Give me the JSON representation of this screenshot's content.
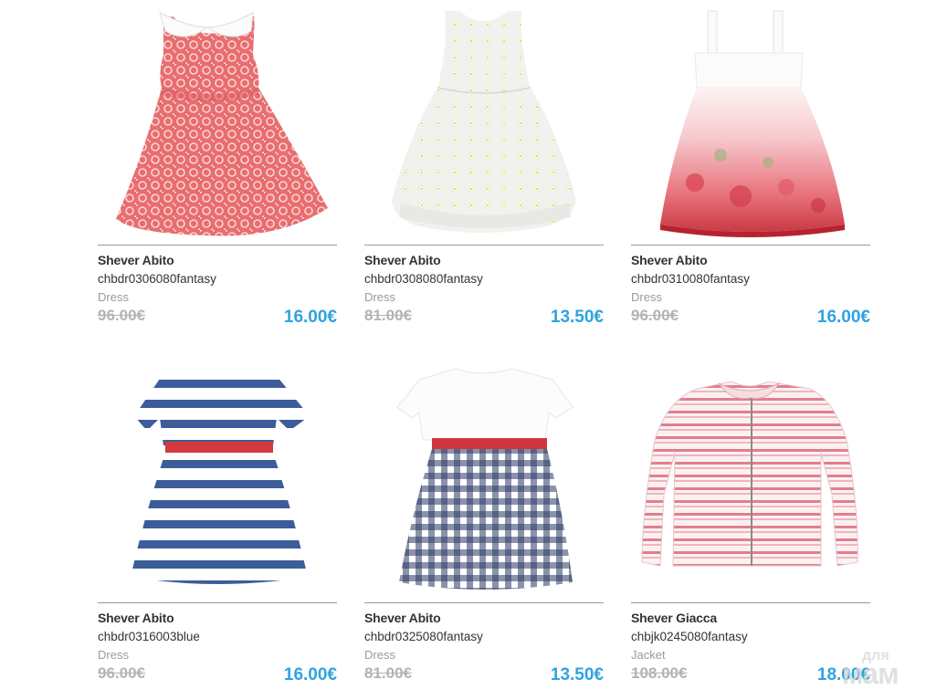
{
  "products": [
    {
      "name": "Shever Abito",
      "sku": "chbdr0306080fantasy",
      "category": "Dress",
      "old_price": "96.00€",
      "price": "16.00€",
      "image_icon": "pink-patterned-dress-image"
    },
    {
      "name": "Shever Abito",
      "sku": "chbdr0308080fantasy",
      "category": "Dress",
      "old_price": "81.00€",
      "price": "13.50€",
      "image_icon": "white-daisy-dress-image"
    },
    {
      "name": "Shever Abito",
      "sku": "chbdr0310080fantasy",
      "category": "Dress",
      "old_price": "96.00€",
      "price": "16.00€",
      "image_icon": "floral-strap-dress-image"
    },
    {
      "name": "Shever Abito",
      "sku": "chbdr0316003blue",
      "category": "Dress",
      "old_price": "96.00€",
      "price": "16.00€",
      "image_icon": "striped-navy-dress-image"
    },
    {
      "name": "Shever Abito",
      "sku": "chbdr0325080fantasy",
      "category": "Dress",
      "old_price": "81.00€",
      "price": "13.50€",
      "image_icon": "gingham-dress-image"
    },
    {
      "name": "Shever Giacca",
      "sku": "chbjk0245080fantasy",
      "category": "Jacket",
      "old_price": "108.00€",
      "price": "18.00€",
      "image_icon": "pink-striped-jacket-image"
    }
  ],
  "watermark": {
    "top": "для",
    "bottom": "мам"
  },
  "colors": {
    "price": "#2ea3e0",
    "old_price": "#b3b3b3",
    "category": "#9b9b9b",
    "divider": "#9a9a9a"
  }
}
